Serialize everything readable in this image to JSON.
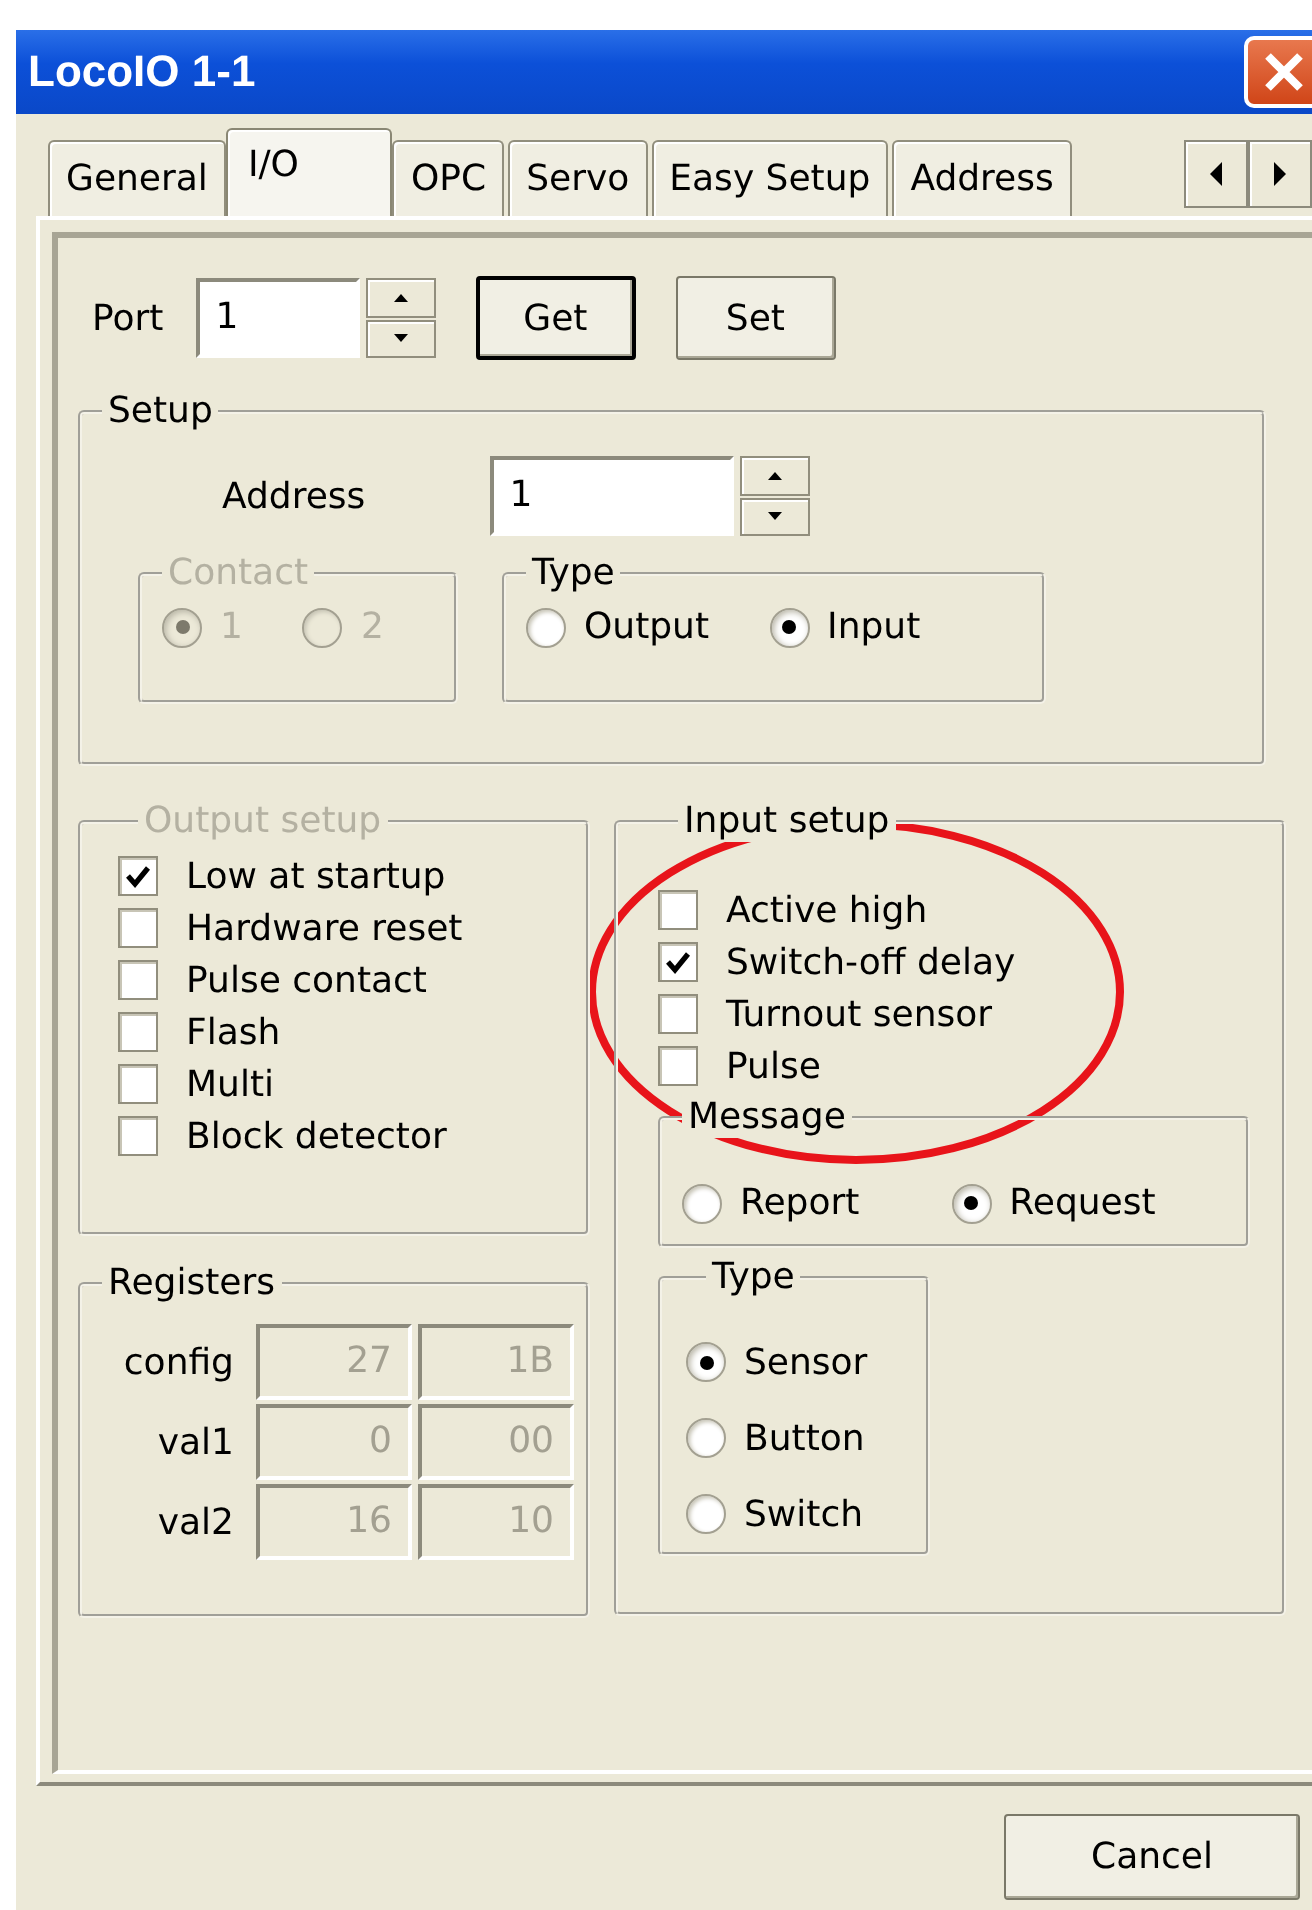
{
  "window": {
    "title": "LocoIO  1-1"
  },
  "tabs": [
    {
      "label": "General",
      "selected": false
    },
    {
      "label": "I/O",
      "selected": true
    },
    {
      "label": "OPC",
      "selected": false
    },
    {
      "label": "Servo",
      "selected": false
    },
    {
      "label": "Easy Setup",
      "selected": false
    },
    {
      "label": "Address",
      "selected": false
    }
  ],
  "port": {
    "label": "Port",
    "value": "1"
  },
  "port_buttons": [
    {
      "label": "Get",
      "default": true
    },
    {
      "label": "Set",
      "default": false
    }
  ],
  "setup": {
    "title": "Setup",
    "address_label": "Address",
    "address_value": "1",
    "contact": {
      "title": "Contact",
      "disabled": true,
      "options": [
        {
          "label": "1",
          "selected": true
        },
        {
          "label": "2",
          "selected": false
        }
      ]
    },
    "type": {
      "title": "Type",
      "disabled": false,
      "options": [
        {
          "label": "Output",
          "selected": false
        },
        {
          "label": "Input",
          "selected": true
        }
      ]
    }
  },
  "output_setup": {
    "title": "Output setup",
    "disabled": true,
    "options": [
      {
        "label": "Low at startup",
        "checked": true
      },
      {
        "label": "Hardware reset",
        "checked": false
      },
      {
        "label": "Pulse contact",
        "checked": false
      },
      {
        "label": "Flash",
        "checked": false
      },
      {
        "label": "Multi",
        "checked": false
      },
      {
        "label": "Block detector",
        "checked": false
      }
    ]
  },
  "registers": {
    "title": "Registers",
    "rows": [
      {
        "label": "config",
        "values": [
          "27",
          "1B"
        ]
      },
      {
        "label": "val1",
        "values": [
          "0",
          "00"
        ]
      },
      {
        "label": "val2",
        "values": [
          "16",
          "10"
        ]
      }
    ]
  },
  "input_setup": {
    "title": "Input setup",
    "disabled": false,
    "options": [
      {
        "label": "Active high",
        "checked": false
      },
      {
        "label": "Switch-off delay",
        "checked": true
      },
      {
        "label": "Turnout sensor",
        "checked": false
      },
      {
        "label": "Pulse",
        "checked": false
      }
    ],
    "message": {
      "title": "Message",
      "disabled": false,
      "options": [
        {
          "label": "Report",
          "selected": false
        },
        {
          "label": "Request",
          "selected": true
        }
      ]
    },
    "type": {
      "title": "Type",
      "disabled": false,
      "options": [
        {
          "label": "Sensor",
          "selected": true
        },
        {
          "label": "Button",
          "selected": false
        },
        {
          "label": "Switch",
          "selected": false
        }
      ]
    }
  },
  "cancel": {
    "label": "Cancel"
  }
}
